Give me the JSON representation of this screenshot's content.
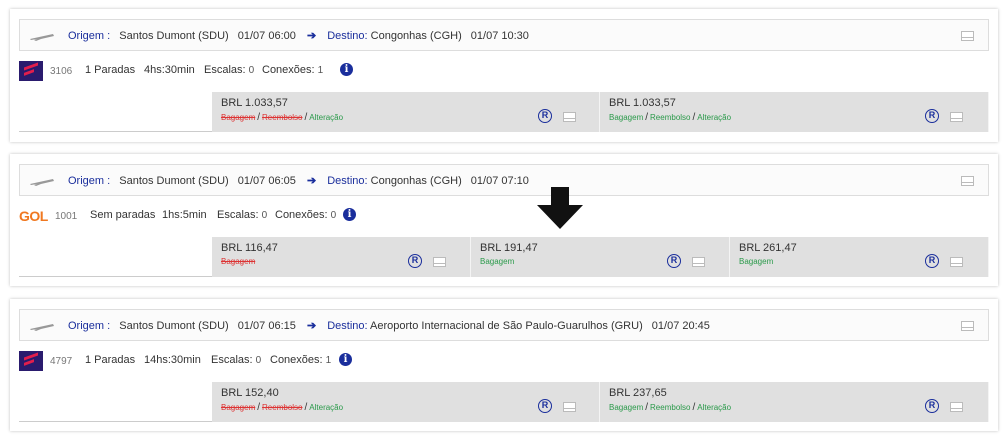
{
  "cards": [
    {
      "origin_label": "Origem :",
      "origin": "Santos Dumont (SDU)",
      "origin_time": "01/07 06:00",
      "dest_label": "Destino:",
      "dest": "Congonhas (CGH)",
      "dest_time": "01/07 10:30",
      "airline": "latam",
      "flight": "3106",
      "stops": "1 Paradas",
      "duration": "4hs:30min",
      "escalas_label": "Escalas:",
      "escalas": "0",
      "conexoes_label": "Conexões:",
      "conexoes": "1",
      "prices": [
        {
          "amount": "BRL 1.033,57",
          "bagagem": "Bagagem",
          "reembolso": "Reembolso",
          "alteracao": "Alteração"
        },
        {
          "amount": "BRL 1.033,57",
          "bagagem": "Bagagem",
          "reembolso": "Reembolso",
          "alteracao": "Alteração"
        }
      ]
    },
    {
      "origin_label": "Origem :",
      "origin": "Santos Dumont (SDU)",
      "origin_time": "01/07 06:05",
      "dest_label": "Destino:",
      "dest": "Congonhas (CGH)",
      "dest_time": "01/07 07:10",
      "airline": "gol",
      "airline_logo_text": "GOL",
      "flight": "1001",
      "stops": "Sem paradas",
      "duration": "1hs:5min",
      "escalas_label": "Escalas:",
      "escalas": "0",
      "conexoes_label": "Conexões:",
      "conexoes": "0",
      "prices": [
        {
          "amount": "BRL 116,47",
          "bagagem": "Bagagem"
        },
        {
          "amount": "BRL 191,47",
          "bagagem": "Bagagem"
        },
        {
          "amount": "BRL 261,47",
          "bagagem": "Bagagem"
        }
      ]
    },
    {
      "origin_label": "Origem :",
      "origin": "Santos Dumont (SDU)",
      "origin_time": "01/07 06:15",
      "dest_label": "Destino:",
      "dest": "Aeroporto Internacional de São Paulo-Guarulhos (GRU)",
      "dest_time": "01/07 20:45",
      "airline": "latam",
      "flight": "4797",
      "stops": "1 Paradas",
      "duration": "14hs:30min",
      "escalas_label": "Escalas:",
      "escalas": "0",
      "conexoes_label": "Conexões:",
      "conexoes": "1",
      "prices": [
        {
          "amount": "BRL 152,40",
          "bagagem": "Bagagem",
          "reembolso": "Reembolso",
          "alteracao": "Alteração"
        },
        {
          "amount": "BRL 237,65",
          "bagagem": "Bagagem",
          "reembolso": "Reembolso",
          "alteracao": "Alteração"
        }
      ]
    }
  ],
  "icons": {
    "plane": "airplane-icon",
    "arrow": "arrow-right-icon",
    "info": "info-icon",
    "refund": "registered-r-icon",
    "mail": "envelope-icon",
    "pointer": "down-arrow-icon"
  },
  "glyphs": {
    "info": "i",
    "refund": "R",
    "arrow": "➔",
    "slash": "/"
  },
  "colors": {
    "accent": "#1a2e9c",
    "ok": "#2a9a4a",
    "strike": "#d33333",
    "gol": "#f07820",
    "latam": "#2a1b6e"
  }
}
